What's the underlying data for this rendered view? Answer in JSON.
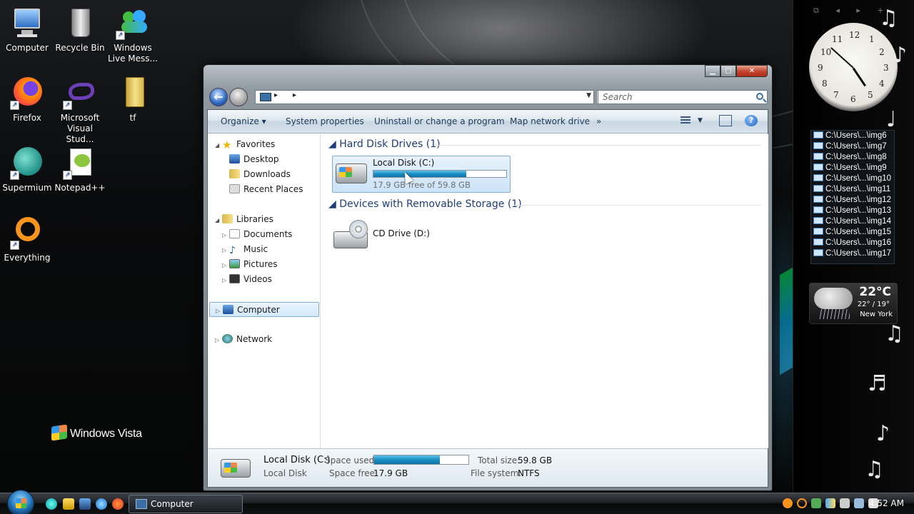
{
  "desktop": {
    "icons": [
      {
        "label": "Computer"
      },
      {
        "label": "Recycle Bin"
      },
      {
        "label": "Windows Live Mess..."
      },
      {
        "label": "Firefox"
      },
      {
        "label": "Microsoft Visual Stud..."
      },
      {
        "label": "tf"
      },
      {
        "label": "Supermium"
      },
      {
        "label": "Notepad++"
      },
      {
        "label": "Everything"
      }
    ],
    "branding": "Windows Vista"
  },
  "sidebar": {
    "clock_numbers": [
      "12",
      "1",
      "2",
      "3",
      "4",
      "5",
      "6",
      "7",
      "8",
      "9",
      "10",
      "11"
    ],
    "slideshow": [
      "C:\\Users\\...\\img6",
      "C:\\Users\\...\\img7",
      "C:\\Users\\...\\img8",
      "C:\\Users\\...\\img9",
      "C:\\Users\\...\\img10",
      "C:\\Users\\...\\img11",
      "C:\\Users\\...\\img12",
      "C:\\Users\\...\\img13",
      "C:\\Users\\...\\img14",
      "C:\\Users\\...\\img15",
      "C:\\Users\\...\\img16",
      "C:\\Users\\...\\img17"
    ],
    "weather": {
      "temp": "22°C",
      "range": "22° / 19°",
      "city": "New York"
    }
  },
  "window": {
    "search_placeholder": "Search",
    "toolbar": {
      "organize": "Organize",
      "system_properties": "System properties",
      "uninstall": "Uninstall or change a program",
      "map_drive": "Map network drive",
      "more": "»"
    },
    "nav_pane": {
      "favorites": "Favorites",
      "desktop": "Desktop",
      "downloads": "Downloads",
      "recent": "Recent Places",
      "libraries": "Libraries",
      "documents": "Documents",
      "music": "Music",
      "pictures": "Pictures",
      "videos": "Videos",
      "computer": "Computer",
      "network": "Network"
    },
    "groups": {
      "hard_disks": "Hard Disk Drives (1)",
      "removable": "Devices with Removable Storage (1)"
    },
    "local_disk": {
      "name": "Local Disk (C:)",
      "free_text": "17.9 GB free of 59.8 GB",
      "used_fraction": 0.7
    },
    "cd_drive": {
      "name": "CD Drive (D:)"
    },
    "details": {
      "name": "Local Disk (C:)",
      "type": "Local Disk",
      "space_used_label": "Space used:",
      "space_free_label": "Space free:",
      "space_free_value": "17.9 GB",
      "total_size_label": "Total size:",
      "total_size_value": "59.8 GB",
      "fs_label": "File system:",
      "fs_value": "NTFS"
    }
  },
  "taskbar": {
    "task_title": "Computer",
    "time": "4:52 AM"
  }
}
